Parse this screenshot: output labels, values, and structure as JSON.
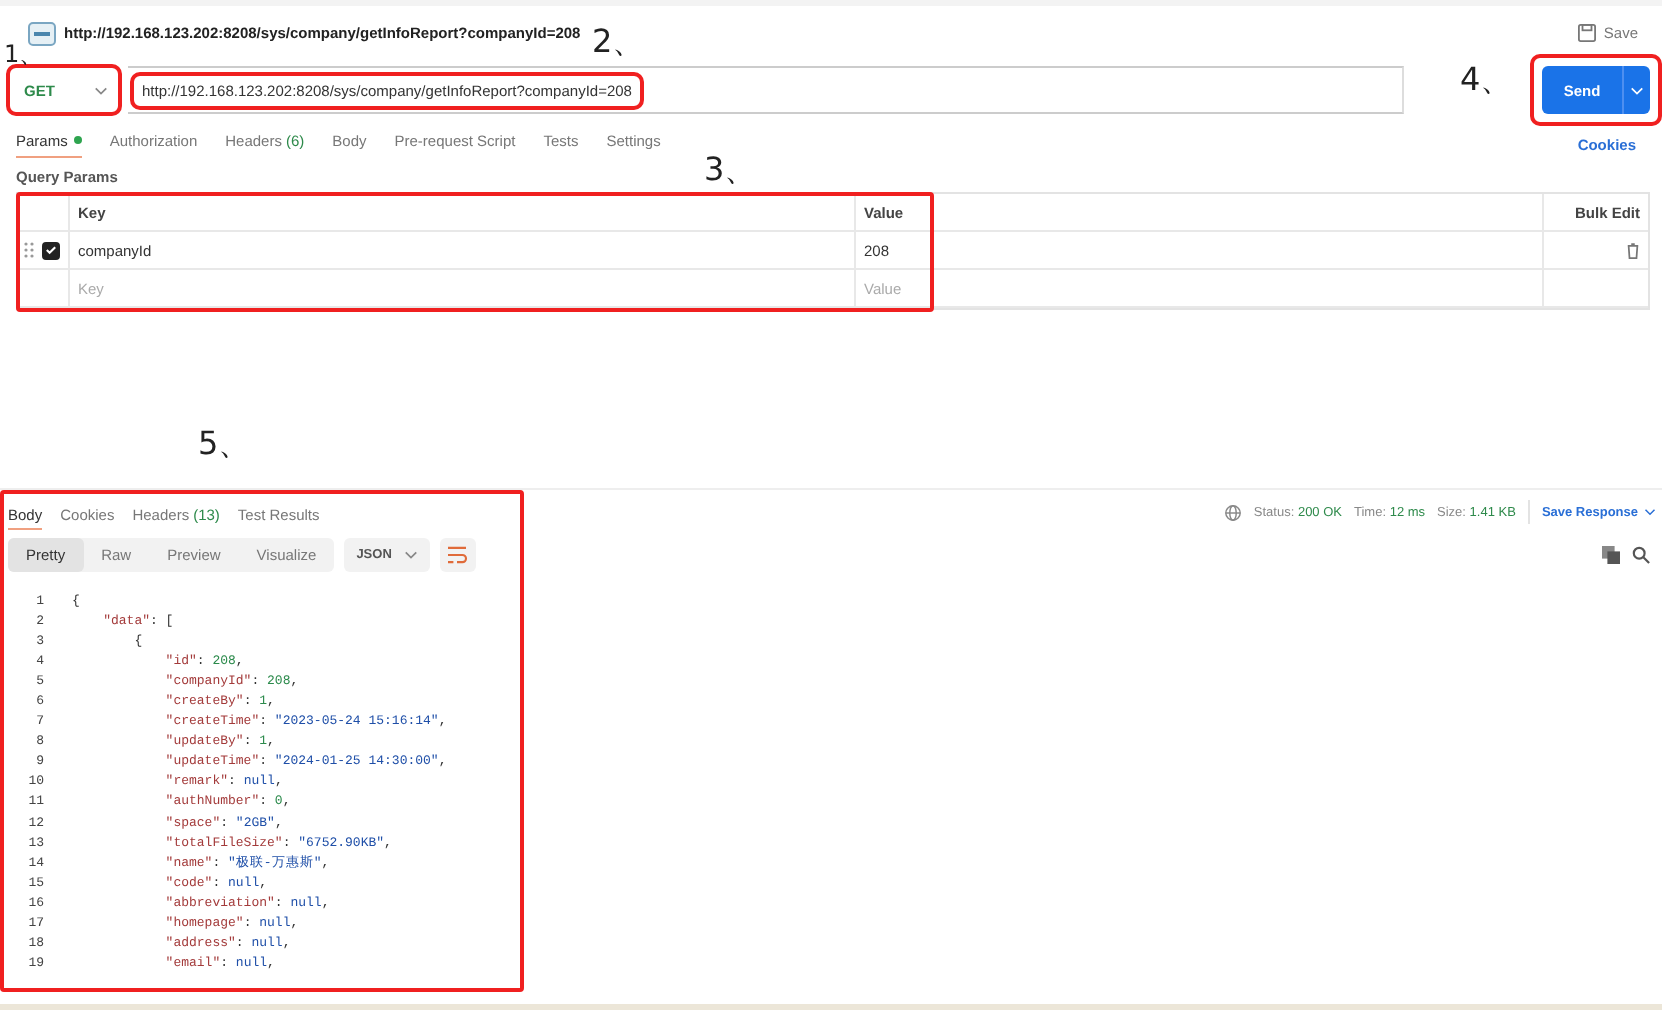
{
  "request": {
    "title": "http://192.168.123.202:8208/sys/company/getInfoReport?companyId=208",
    "save": "Save",
    "method": "GET",
    "url": "http://192.168.123.202:8208/sys/company/getInfoReport?companyId=208",
    "send": "Send"
  },
  "request_tabs": [
    {
      "label": "Params",
      "selected": true,
      "dot": true
    },
    {
      "label": "Authorization",
      "selected": false,
      "dot": false
    },
    {
      "label": "Headers",
      "count": "(6)",
      "selected": false,
      "dot": false
    },
    {
      "label": "Body",
      "selected": false,
      "dot": false
    },
    {
      "label": "Pre-request Script",
      "selected": false,
      "dot": false
    },
    {
      "label": "Tests",
      "selected": false,
      "dot": false
    },
    {
      "label": "Settings",
      "selected": false,
      "dot": false
    }
  ],
  "cookies_link": "Cookies",
  "query_params": {
    "title": "Query Params",
    "columns": [
      "Key",
      "Value",
      "Bulk Edit"
    ],
    "rows": [
      {
        "key": "companyId",
        "value": "208",
        "checked": true
      }
    ],
    "placeholder_key": "Key",
    "placeholder_value": "Value"
  },
  "response_tabs": [
    {
      "label": "Body",
      "selected": true
    },
    {
      "label": "Cookies",
      "selected": false
    },
    {
      "label": "Headers",
      "count": "(13)",
      "selected": false
    },
    {
      "label": "Test Results",
      "selected": false
    }
  ],
  "status": {
    "status_label": "Status:",
    "status": "200 OK",
    "time_label": "Time:",
    "time": "12 ms",
    "size_label": "Size:",
    "size": "1.41 KB",
    "save_response": "Save Response"
  },
  "views": [
    {
      "label": "Pretty",
      "selected": true
    },
    {
      "label": "Raw",
      "selected": false
    },
    {
      "label": "Preview",
      "selected": false
    },
    {
      "label": "Visualize",
      "selected": false
    }
  ],
  "format": "JSON",
  "code": [
    {
      "number": "1",
      "tokens": [
        {
          "kind": "punct",
          "text": "{"
        }
      ],
      "children": [
        {
          "number": "2",
          "tokens": [
            {
              "kind": "key",
              "text": "\"data\""
            },
            {
              "kind": "punct",
              "text": ": ["
            }
          ],
          "children": [
            {
              "number": "3",
              "tokens": [
                {
                  "kind": "punct",
                  "text": "{"
                }
              ],
              "children": [
                {
                  "number": "4",
                  "tokens": [
                    {
                      "kind": "key",
                      "text": "\"id\""
                    },
                    {
                      "kind": "punct",
                      "text": ": "
                    },
                    {
                      "kind": "number",
                      "text": "208"
                    },
                    {
                      "kind": "punct",
                      "text": ","
                    }
                  ]
                },
                {
                  "number": "5",
                  "tokens": [
                    {
                      "kind": "key",
                      "text": "\"companyId\""
                    },
                    {
                      "kind": "punct",
                      "text": ": "
                    },
                    {
                      "kind": "number",
                      "text": "208"
                    },
                    {
                      "kind": "punct",
                      "text": ","
                    }
                  ]
                },
                {
                  "number": "6",
                  "tokens": [
                    {
                      "kind": "key",
                      "text": "\"createBy\""
                    },
                    {
                      "kind": "punct",
                      "text": ": "
                    },
                    {
                      "kind": "number",
                      "text": "1"
                    },
                    {
                      "kind": "punct",
                      "text": ","
                    }
                  ]
                },
                {
                  "number": "7",
                  "tokens": [
                    {
                      "kind": "key",
                      "text": "\"createTime\""
                    },
                    {
                      "kind": "punct",
                      "text": ": "
                    },
                    {
                      "kind": "string",
                      "text": "\"2023-05-24 15:16:14\""
                    },
                    {
                      "kind": "punct",
                      "text": ","
                    }
                  ]
                },
                {
                  "number": "8",
                  "tokens": [
                    {
                      "kind": "key",
                      "text": "\"updateBy\""
                    },
                    {
                      "kind": "punct",
                      "text": ": "
                    },
                    {
                      "kind": "number",
                      "text": "1"
                    },
                    {
                      "kind": "punct",
                      "text": ","
                    }
                  ]
                },
                {
                  "number": "9",
                  "tokens": [
                    {
                      "kind": "key",
                      "text": "\"updateTime\""
                    },
                    {
                      "kind": "punct",
                      "text": ": "
                    },
                    {
                      "kind": "string",
                      "text": "\"2024-01-25 14:30:00\""
                    },
                    {
                      "kind": "punct",
                      "text": ","
                    }
                  ]
                },
                {
                  "number": "10",
                  "tokens": [
                    {
                      "kind": "key",
                      "text": "\"remark\""
                    },
                    {
                      "kind": "punct",
                      "text": ": "
                    },
                    {
                      "kind": "null",
                      "text": "null"
                    },
                    {
                      "kind": "punct",
                      "text": ","
                    }
                  ]
                },
                {
                  "number": "11",
                  "tokens": [
                    {
                      "kind": "key",
                      "text": "\"authNumber\""
                    },
                    {
                      "kind": "punct",
                      "text": ": "
                    },
                    {
                      "kind": "number",
                      "text": "0"
                    },
                    {
                      "kind": "punct",
                      "text": ","
                    }
                  ]
                },
                {
                  "number": "12",
                  "tokens": [
                    {
                      "kind": "key",
                      "text": "\"space\""
                    },
                    {
                      "kind": "punct",
                      "text": ": "
                    },
                    {
                      "kind": "string",
                      "text": "\"2GB\""
                    },
                    {
                      "kind": "punct",
                      "text": ","
                    }
                  ]
                },
                {
                  "number": "13",
                  "tokens": [
                    {
                      "kind": "key",
                      "text": "\"totalFileSize\""
                    },
                    {
                      "kind": "punct",
                      "text": ": "
                    },
                    {
                      "kind": "string",
                      "text": "\"6752.90KB\""
                    },
                    {
                      "kind": "punct",
                      "text": ","
                    }
                  ]
                },
                {
                  "number": "14",
                  "tokens": [
                    {
                      "kind": "key",
                      "text": "\"name\""
                    },
                    {
                      "kind": "punct",
                      "text": ": "
                    },
                    {
                      "kind": "string",
                      "text": "\"极联-万惠斯\""
                    },
                    {
                      "kind": "punct",
                      "text": ","
                    }
                  ]
                },
                {
                  "number": "15",
                  "tokens": [
                    {
                      "kind": "key",
                      "text": "\"code\""
                    },
                    {
                      "kind": "punct",
                      "text": ": "
                    },
                    {
                      "kind": "null",
                      "text": "null"
                    },
                    {
                      "kind": "punct",
                      "text": ","
                    }
                  ]
                },
                {
                  "number": "16",
                  "tokens": [
                    {
                      "kind": "key",
                      "text": "\"abbreviation\""
                    },
                    {
                      "kind": "punct",
                      "text": ": "
                    },
                    {
                      "kind": "null",
                      "text": "null"
                    },
                    {
                      "kind": "punct",
                      "text": ","
                    }
                  ]
                },
                {
                  "number": "17",
                  "tokens": [
                    {
                      "kind": "key",
                      "text": "\"homepage\""
                    },
                    {
                      "kind": "punct",
                      "text": ": "
                    },
                    {
                      "kind": "null",
                      "text": "null"
                    },
                    {
                      "kind": "punct",
                      "text": ","
                    }
                  ]
                },
                {
                  "number": "18",
                  "tokens": [
                    {
                      "kind": "key",
                      "text": "\"address\""
                    },
                    {
                      "kind": "punct",
                      "text": ": "
                    },
                    {
                      "kind": "null",
                      "text": "null"
                    },
                    {
                      "kind": "punct",
                      "text": ","
                    }
                  ]
                },
                {
                  "number": "19",
                  "tokens": [
                    {
                      "kind": "key",
                      "text": "\"email\""
                    },
                    {
                      "kind": "punct",
                      "text": ": "
                    },
                    {
                      "kind": "null",
                      "text": "null"
                    },
                    {
                      "kind": "punct",
                      "text": ","
                    }
                  ]
                }
              ]
            }
          ]
        }
      ]
    }
  ],
  "annotations": [
    {
      "label": "1、"
    },
    {
      "label": "2、"
    },
    {
      "label": "3、"
    },
    {
      "label": "4、"
    },
    {
      "label": "5、"
    }
  ]
}
